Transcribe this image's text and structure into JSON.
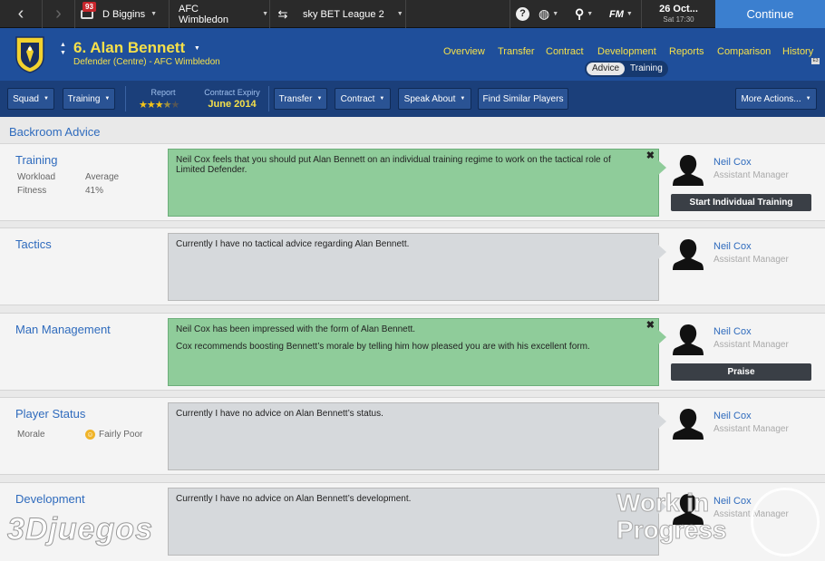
{
  "topbar": {
    "manager": "D Biggins",
    "inbox_count": "93",
    "club": "AFC Wimbledon",
    "league": "sky BET League 2",
    "date_main": "26 Oct...",
    "date_sub": "Sat 17:30",
    "continue_label": "Continue"
  },
  "player": {
    "name": "6. Alan Bennett",
    "subtitle": "Defender (Centre) - AFC Wimbledon",
    "nav": [
      "Overview",
      "Transfer",
      "Contract",
      "Development",
      "Reports",
      "Comparison",
      "History"
    ],
    "subtabs": [
      "Advice",
      "Training"
    ]
  },
  "toolbar": {
    "squad": "Squad",
    "training": "Training",
    "report_label": "Report",
    "report_stars": 3,
    "report_stars_max": 5,
    "contract_label": "Contract Expiry",
    "contract_value": "June 2014",
    "transfer": "Transfer",
    "contract": "Contract",
    "speak_about": "Speak About",
    "find_similar": "Find Similar Players",
    "more_actions": "More Actions..."
  },
  "section_title": "Backroom Advice",
  "cards": [
    {
      "title": "Training",
      "rows": [
        {
          "label": "Workload",
          "value": "Average"
        },
        {
          "label": "Fitness",
          "value": "41%"
        }
      ],
      "advice": [
        "Neil Cox feels that you should put Alan Bennett on an individual training regime to work on the tactical role of Limited Defender."
      ],
      "staff": "Neil Cox",
      "role": "Assistant Manager",
      "action": "Start Individual Training"
    },
    {
      "title": "Tactics",
      "advice": [
        "Currently I have no tactical advice regarding Alan Bennett."
      ],
      "staff": "Neil Cox",
      "role": "Assistant Manager"
    },
    {
      "title": "Man Management",
      "advice": [
        "Neil Cox has been impressed with the form of Alan Bennett.",
        "Cox recommends boosting Bennett’s morale by telling him how pleased you are with his excellent form."
      ],
      "staff": "Neil Cox",
      "role": "Assistant Manager",
      "action": "Praise"
    },
    {
      "title": "Player Status",
      "rows": [
        {
          "label": "Morale",
          "value": "Fairly Poor"
        }
      ],
      "advice": [
        "Currently I have no advice on Alan Bennett’s status."
      ],
      "staff": "Neil Cox",
      "role": "Assistant Manager"
    },
    {
      "title": "Development",
      "advice": [
        "Currently I have no advice on Alan Bennett’s development."
      ],
      "staff": "Neil Cox",
      "role": "Assistant Manager"
    }
  ],
  "watermarks": {
    "site": "3Djuegos",
    "wip": "Work in Progress"
  }
}
